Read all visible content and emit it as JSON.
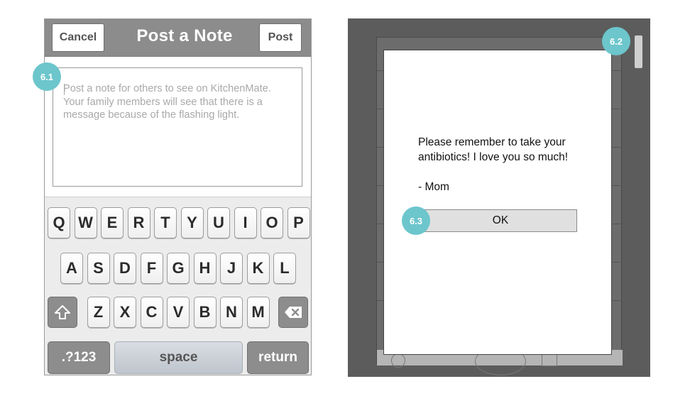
{
  "compose_screen": {
    "nav": {
      "cancel_label": "Cancel",
      "title": "Post a Note",
      "post_label": "Post"
    },
    "note": {
      "placeholder": "Post a note for others to see on KitchenMate. Your family members will see that there is a message because of the flashing light."
    },
    "keyboard": {
      "row1": [
        "Q",
        "W",
        "E",
        "R",
        "T",
        "Y",
        "U",
        "I",
        "O",
        "P"
      ],
      "row2": [
        "A",
        "S",
        "D",
        "F",
        "G",
        "H",
        "J",
        "K",
        "L"
      ],
      "row3": [
        "Z",
        "X",
        "C",
        "V",
        "B",
        "N",
        "M"
      ],
      "numbers_label": ".?123",
      "space_label": "space",
      "return_label": "return",
      "shift_icon": "shift-arrow-icon",
      "delete_icon": "backspace-icon"
    }
  },
  "display_screen": {
    "dialog": {
      "message": "Please remember to take your antibiotics! I love you so much!",
      "signature": "- Mom",
      "ok_label": "OK"
    }
  },
  "callouts": {
    "c1": "6.1",
    "c2": "6.2",
    "c3": "6.3"
  },
  "colors": {
    "navbar": "#8c8c8c",
    "callout": "#6cc6cc",
    "device_bg": "#5c5c5c"
  }
}
